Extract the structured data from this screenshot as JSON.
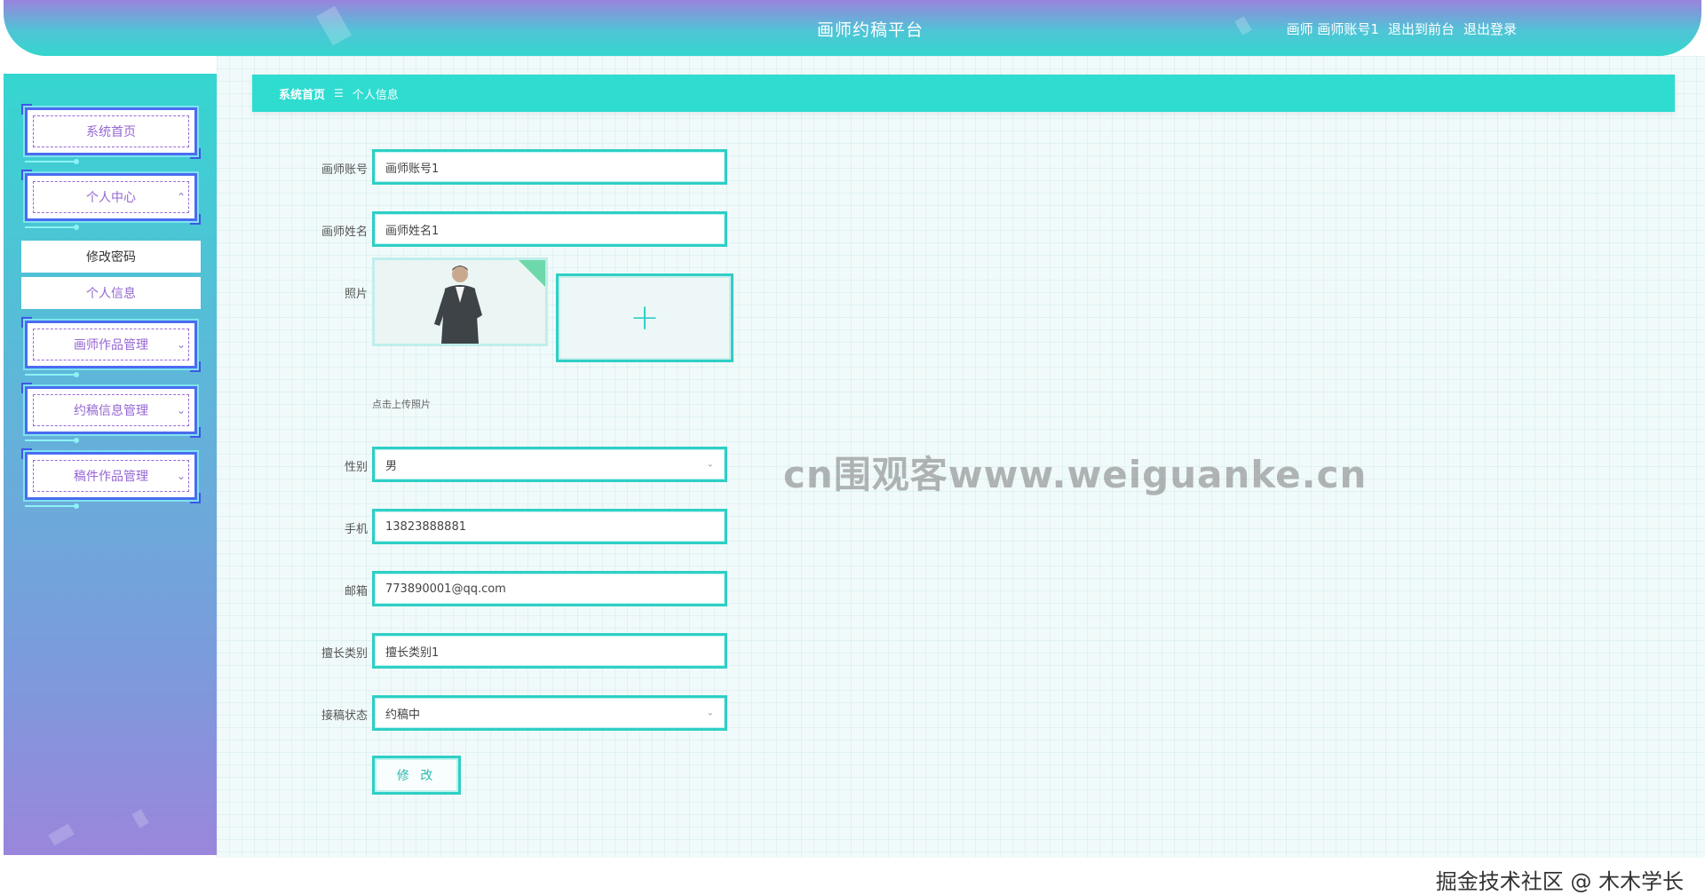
{
  "header": {
    "title": "画师约稿平台",
    "user_role": "画师",
    "user_name": "画师账号1",
    "front_link": "退出到前台",
    "logout_link": "退出登录"
  },
  "sidebar": {
    "items": [
      {
        "label": "系统首页"
      },
      {
        "label": "个人中心",
        "expanded": true
      },
      {
        "label": "画师作品管理"
      },
      {
        "label": "约稿信息管理"
      },
      {
        "label": "稿件作品管理"
      }
    ],
    "sub_items": [
      {
        "label": "修改密码"
      },
      {
        "label": "个人信息"
      }
    ]
  },
  "breadcrumb": {
    "home": "系统首页",
    "separator": "☰",
    "current": "个人信息"
  },
  "form": {
    "account_label": "画师账号",
    "account_value": "画师账号1",
    "name_label": "画师姓名",
    "name_value": "画师姓名1",
    "photo_label": "照片",
    "upload_hint": "点击上传照片",
    "upload_plus": "+",
    "gender_label": "性别",
    "gender_value": "男",
    "phone_label": "手机",
    "phone_value": "13823888881",
    "email_label": "邮箱",
    "email_value": "773890001@qq.com",
    "specialty_label": "擅长类别",
    "specialty_value": "擅长类别1",
    "status_label": "接稿状态",
    "status_value": "约稿中",
    "submit_label": "修 改"
  },
  "watermark": "cn围观客www.weiguanke.cn",
  "credit": "掘金技术社区 @ 木木学长",
  "colors": {
    "accent": "#2fcfc5",
    "menu_text": "#9566d3",
    "menu_border": "#4a6cf0"
  }
}
